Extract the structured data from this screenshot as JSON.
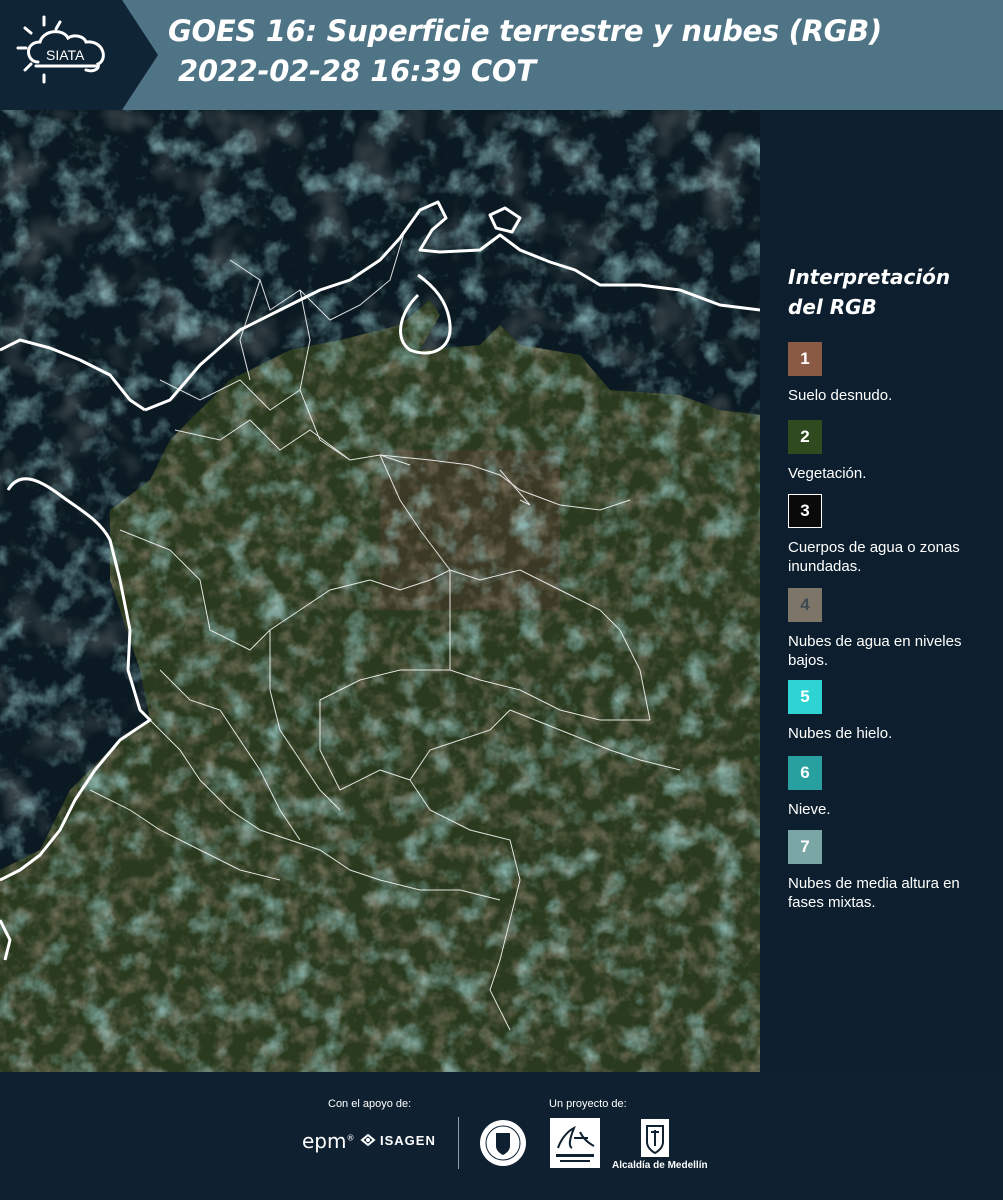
{
  "header": {
    "logo_text": "SIATA",
    "title_line1": "GOES 16: Superficie terrestre y nubes (RGB)",
    "title_line2": "2022-02-28 16:39 COT"
  },
  "map": {
    "background_color": "#0b1a24",
    "border_color": "#ffffff"
  },
  "legend": {
    "title_line1": "Interpretación",
    "title_line2": "del RGB",
    "items": [
      {
        "number": "1",
        "label": "Suelo desnudo.",
        "color": "#8b5a45"
      },
      {
        "number": "2",
        "label": "Vegetación.",
        "color": "#2f4a1e"
      },
      {
        "number": "3",
        "label": "Cuerpos de agua o zonas inundadas.",
        "color": "#0a0a0a"
      },
      {
        "number": "4",
        "label": "Nubes de agua en niveles bajos.",
        "color": "#7c7568"
      },
      {
        "number": "5",
        "label": "Nubes de hielo.",
        "color": "#2ed4d4"
      },
      {
        "number": "6",
        "label": "Nieve.",
        "color": "#29a0a0"
      },
      {
        "number": "7",
        "label": "Nubes de media altura en fases mixtas.",
        "color": "#7aa6a6"
      }
    ]
  },
  "footer": {
    "support_label": "Con el apoyo de:",
    "project_label": "Un proyecto de:",
    "sponsor_epm": "epm",
    "sponsor_isagen": "ISAGEN",
    "partner_alcaldia": "Alcaldía de Medellín"
  }
}
